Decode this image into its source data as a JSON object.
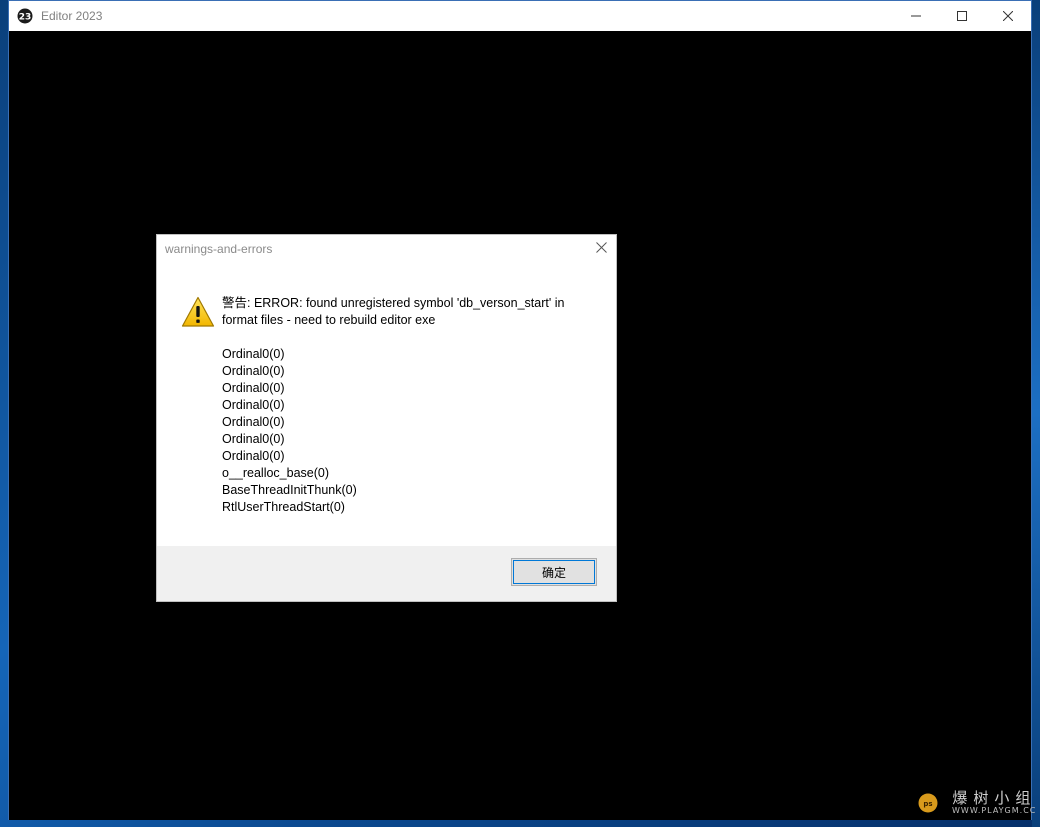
{
  "window": {
    "title": "Editor 2023",
    "app_icon": "editor-logo-icon",
    "controls": {
      "minimize": "minimize-icon",
      "maximize": "maximize-icon",
      "close": "close-icon"
    }
  },
  "dialog": {
    "title": "warnings-and-errors",
    "icon": "warning-icon",
    "message_lines": [
      "警告: ERROR: found unregistered symbol 'db_verson_start' in",
      "format files - need to rebuild editor exe"
    ],
    "trace": [
      "Ordinal0(0)",
      "Ordinal0(0)",
      "Ordinal0(0)",
      "Ordinal0(0)",
      "Ordinal0(0)",
      "Ordinal0(0)",
      "Ordinal0(0)",
      "o__realloc_base(0)",
      "BaseThreadInitThunk(0)",
      "RtlUserThreadStart(0)"
    ],
    "ok_label": "确定"
  },
  "watermark": {
    "cn": "爆树小组",
    "en": "WWW.PLAYGM.CC",
    "logo_text": "ps"
  },
  "colors": {
    "desktop": "#1565b8",
    "warning_yellow": "#f7c600",
    "button_focus": "#0078d7"
  }
}
